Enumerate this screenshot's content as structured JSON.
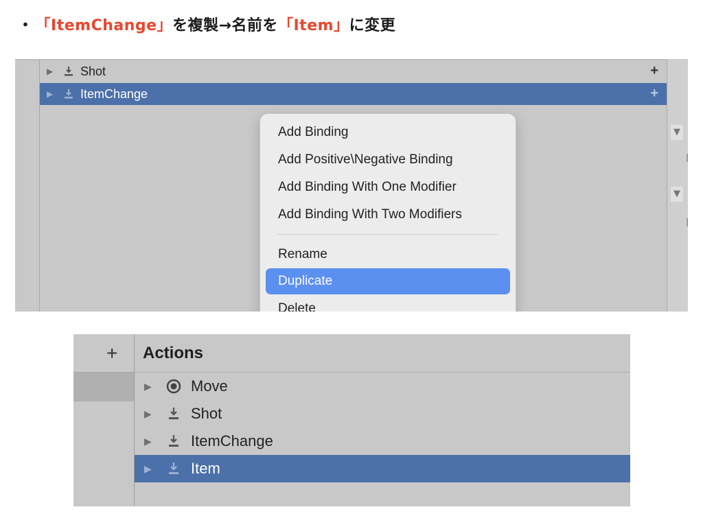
{
  "instruction": {
    "bullet": "・",
    "quote1": "「ItemChange」",
    "text1": "を複製→名前を",
    "quote2": "「Item」",
    "text2": "に変更"
  },
  "panel1": {
    "rows": [
      {
        "label": "Shot",
        "icon": "action-button-icon",
        "selected": false
      },
      {
        "label": "ItemChange",
        "icon": "action-button-icon",
        "selected": true
      }
    ],
    "add_glyph": "+"
  },
  "context_menu": {
    "items": [
      {
        "label": "Add Binding"
      },
      {
        "label": "Add Positive\\Negative Binding"
      },
      {
        "label": "Add Binding With One Modifier"
      },
      {
        "label": "Add Binding With Two Modifiers"
      },
      {
        "label": "Rename"
      },
      {
        "label": "Duplicate",
        "highlighted": true
      },
      {
        "label": "Delete"
      }
    ]
  },
  "panel2": {
    "add_glyph": "+",
    "title": "Actions",
    "rows": [
      {
        "label": "Move",
        "icon": "action-value-icon",
        "selected": false
      },
      {
        "label": "Shot",
        "icon": "action-button-icon",
        "selected": false
      },
      {
        "label": "ItemChange",
        "icon": "action-button-icon",
        "selected": false
      },
      {
        "label": "Item",
        "icon": "action-button-icon",
        "selected": true
      }
    ]
  },
  "colors": {
    "accent_text": "#e8472e",
    "selection": "#4c70a9",
    "menu_highlight": "#5b8ff0",
    "panel_bg": "#c8c8c8"
  }
}
